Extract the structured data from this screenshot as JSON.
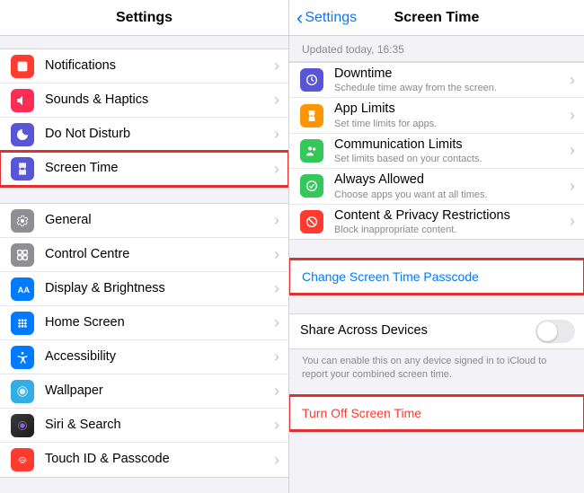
{
  "left": {
    "title": "Settings",
    "group1": [
      {
        "label": "Notifications",
        "icon": "notifications-icon",
        "color": "c-red"
      },
      {
        "label": "Sounds & Haptics",
        "icon": "sounds-icon",
        "color": "c-pink"
      },
      {
        "label": "Do Not Disturb",
        "icon": "dnd-icon",
        "color": "c-indigo"
      },
      {
        "label": "Screen Time",
        "icon": "screentime-icon",
        "color": "c-indigo",
        "highlight": true
      }
    ],
    "group2": [
      {
        "label": "General",
        "icon": "general-icon",
        "color": "c-grey"
      },
      {
        "label": "Control Centre",
        "icon": "control-centre-icon",
        "color": "c-grey"
      },
      {
        "label": "Display & Brightness",
        "icon": "display-icon",
        "color": "c-blue"
      },
      {
        "label": "Home Screen",
        "icon": "home-screen-icon",
        "color": "c-blue"
      },
      {
        "label": "Accessibility",
        "icon": "accessibility-icon",
        "color": "c-blue"
      },
      {
        "label": "Wallpaper",
        "icon": "wallpaper-icon",
        "color": "c-cyan"
      },
      {
        "label": "Siri & Search",
        "icon": "siri-icon",
        "color": "c-grey"
      },
      {
        "label": "Touch ID & Passcode",
        "icon": "touchid-icon",
        "color": "c-red"
      }
    ]
  },
  "right": {
    "back": "Settings",
    "title": "Screen Time",
    "status": "Updated today, 16:35",
    "options": [
      {
        "label": "Downtime",
        "sub": "Schedule time away from the screen.",
        "icon": "downtime-icon",
        "color": "c-indigo"
      },
      {
        "label": "App Limits",
        "sub": "Set time limits for apps.",
        "icon": "applimits-icon",
        "color": "c-orange"
      },
      {
        "label": "Communication Limits",
        "sub": "Set limits based on your contacts.",
        "icon": "commlimits-icon",
        "color": "c-green"
      },
      {
        "label": "Always Allowed",
        "sub": "Choose apps you want at all times.",
        "icon": "allowed-icon",
        "color": "c-green"
      },
      {
        "label": "Content & Privacy Restrictions",
        "sub": "Block inappropriate content.",
        "icon": "restrictions-icon",
        "color": "c-red"
      }
    ],
    "change_passcode": "Change Screen Time Passcode",
    "share_label": "Share Across Devices",
    "share_note": "You can enable this on any device signed in to iCloud to report your combined screen time.",
    "turn_off": "Turn Off Screen Time"
  }
}
